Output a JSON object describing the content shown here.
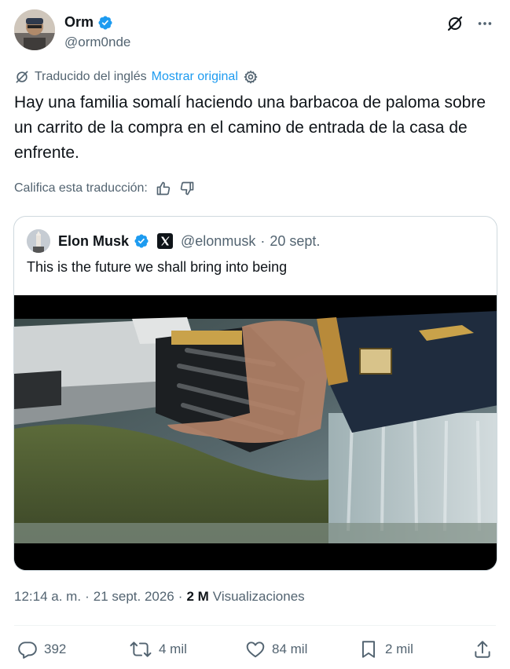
{
  "author": {
    "name": "Orm",
    "handle": "@orm0nde",
    "verified": true
  },
  "translation": {
    "label": "Traducido del inglés",
    "show_original": "Mostrar original"
  },
  "tweet": {
    "text": "Hay una familia somalí haciendo una barbacoa de paloma sobre un carrito de la compra en el camino de entrada de la casa de enfrente."
  },
  "rating": {
    "label": "Califica esta traducción:"
  },
  "quoted": {
    "name": "Elon Musk",
    "handle": "@elonmusk",
    "separator": "·",
    "date": "20 sept.",
    "text": "This is the future we shall bring into being"
  },
  "meta": {
    "time": "12:14 a. m.",
    "sep1": "·",
    "date": "21 sept. 2026",
    "sep2": "·",
    "views_count": "2 M",
    "views_label": "Visualizaciones"
  },
  "actions": {
    "replies": "392",
    "reposts": "4 mil",
    "likes": "84 mil",
    "bookmarks": "2 mil"
  },
  "colors": {
    "accent": "#1d9bf0",
    "text_primary": "#0f1419",
    "text_secondary": "#536471",
    "border": "#cfd9de"
  },
  "icons": [
    "grok-icon",
    "more-icon",
    "translate-icon",
    "settings-icon",
    "thumbs-up-icon",
    "thumbs-down-icon",
    "verified-icon",
    "x-logo-icon",
    "reply-icon",
    "repost-icon",
    "like-icon",
    "bookmark-icon",
    "share-icon"
  ]
}
